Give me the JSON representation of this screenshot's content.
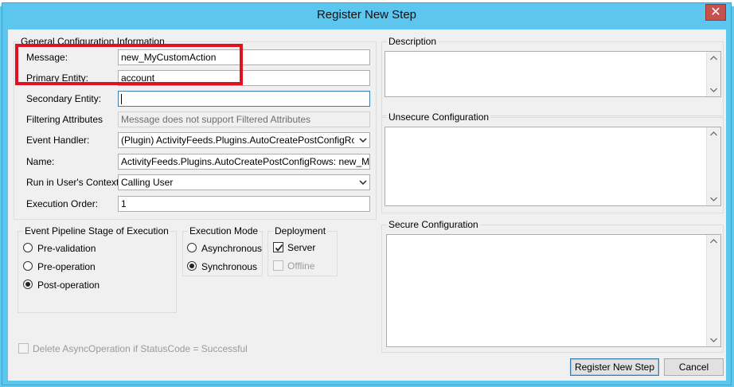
{
  "window": {
    "title": "Register New Step",
    "close_glyph": "✕"
  },
  "general": {
    "legend": "General Configuration Information",
    "message": {
      "label": "Message:",
      "value": "new_MyCustomAction"
    },
    "primary_entity": {
      "label": "Primary Entity:",
      "value": "account"
    },
    "secondary_entity": {
      "label": "Secondary Entity:",
      "value": ""
    },
    "filtering_attributes": {
      "label": "Filtering Attributes",
      "value": "Message does not support Filtered Attributes"
    },
    "event_handler": {
      "label": "Event Handler:",
      "value": "(Plugin) ActivityFeeds.Plugins.AutoCreatePostConfigRows"
    },
    "name": {
      "label": "Name:",
      "value": "ActivityFeeds.Plugins.AutoCreatePostConfigRows: new_MyCustor"
    },
    "run_context": {
      "label": "Run in User's Context:",
      "value": "Calling User"
    },
    "execution_order": {
      "label": "Execution Order:",
      "value": "1"
    }
  },
  "pipeline": {
    "legend": "Event Pipeline Stage of Execution",
    "options": [
      "Pre-validation",
      "Pre-operation",
      "Post-operation"
    ],
    "selected": "Post-operation"
  },
  "execution_mode": {
    "legend": "Execution Mode",
    "options": [
      "Asynchronous",
      "Synchronous"
    ],
    "selected": "Synchronous"
  },
  "deployment": {
    "legend": "Deployment",
    "server": {
      "label": "Server",
      "checked": true
    },
    "offline": {
      "label": "Offline",
      "checked": false,
      "enabled": false
    }
  },
  "delete_async": {
    "label": "Delete AsyncOperation if StatusCode = Successful",
    "checked": false,
    "enabled": false
  },
  "description": {
    "legend": "Description"
  },
  "unsecure": {
    "legend": "Unsecure Configuration"
  },
  "secure": {
    "legend": "Secure Configuration"
  },
  "buttons": {
    "register": "Register New Step",
    "cancel": "Cancel"
  },
  "colors": {
    "window_frame": "#5cc6ee",
    "highlight": "#e0121f",
    "dialog_bg": "#f0f0f0"
  },
  "icons": [
    "close-icon",
    "dropdown-arrow-icon",
    "scroll-up-icon",
    "scroll-down-icon",
    "checkmark-icon"
  ]
}
